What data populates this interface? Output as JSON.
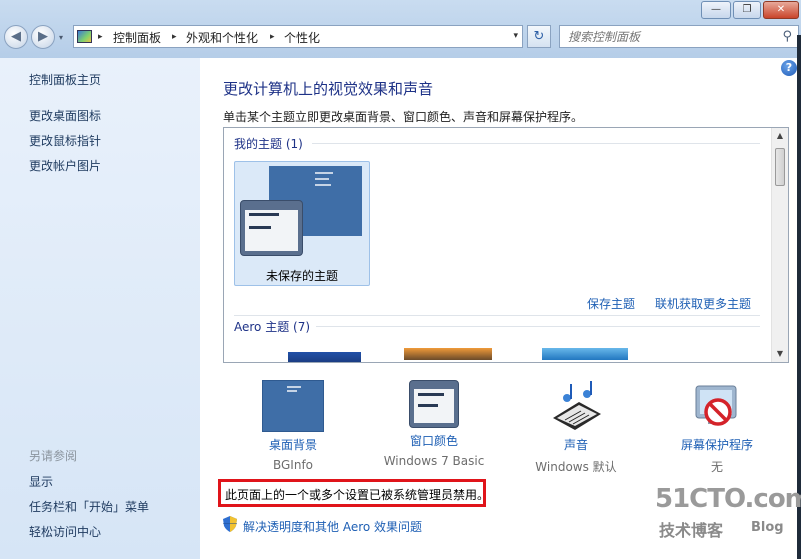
{
  "window": {
    "minimize_glyph": "—",
    "maximize_glyph": "❐",
    "close_glyph": "✕"
  },
  "nav": {
    "back_glyph": "◀",
    "forward_glyph": "▶",
    "dropdown_glyph": "▾"
  },
  "address": {
    "icon": "control-panel-icon",
    "crumbs": [
      "控制面板",
      "外观和个性化",
      "个性化"
    ],
    "separator": "▸",
    "dropdown_glyph": "▾"
  },
  "refresh_glyph": "↻",
  "search": {
    "placeholder": "搜索控制面板",
    "icon_glyph": "⚲"
  },
  "sidebar": {
    "home": "控制面板主页",
    "links": [
      "更改桌面图标",
      "更改鼠标指针",
      "更改帐户图片"
    ],
    "see_also_heading": "另请参阅",
    "see_also": [
      "显示",
      "任务栏和「开始」菜单",
      "轻松访问中心"
    ]
  },
  "main": {
    "help_glyph": "?",
    "title": "更改计算机上的视觉效果和声音",
    "subtitle": "单击某个主题立即更改桌面背景、窗口颜色、声音和屏幕保护程序。",
    "my_themes_label": "我的主题 (1)",
    "unsaved_theme": "未保存的主题",
    "save_theme": "保存主题",
    "get_more_themes": "联机获取更多主题",
    "aero_label": "Aero 主题 (7)"
  },
  "settings": [
    {
      "label": "桌面背景",
      "value": "BGInfo"
    },
    {
      "label": "窗口颜色",
      "value": "Windows 7 Basic"
    },
    {
      "label": "声音",
      "value": "Windows 默认"
    },
    {
      "label": "屏幕保护程序",
      "value": "无"
    }
  ],
  "alert": "此页面上的一个或多个设置已被系统管理员禁用。",
  "fix_link": "解决透明度和其他 Aero 效果问题",
  "watermark": {
    "big": "51CTO.com",
    "small": "技术博客",
    "blog": "Blog"
  }
}
